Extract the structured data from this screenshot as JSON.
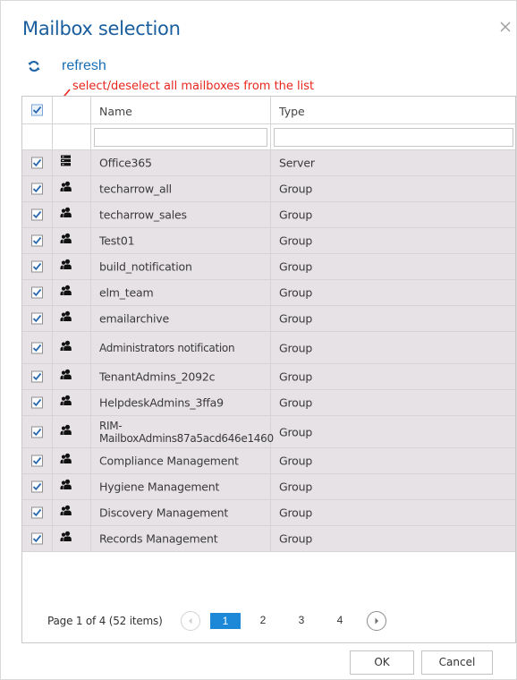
{
  "dialog": {
    "title": "Mailbox selection",
    "close_icon": "close-icon",
    "refresh_label": "refresh",
    "refresh_icon": "refresh-icon",
    "annotation": "select/deselect all mailboxes from the list"
  },
  "grid": {
    "columns": [
      "",
      "",
      "Name",
      "Type"
    ],
    "select_all_checked": true,
    "filter_name_value": "",
    "filter_type_value": "",
    "rows": [
      {
        "checked": true,
        "icon": "server-icon",
        "name": "Office365",
        "type": "Server"
      },
      {
        "checked": true,
        "icon": "group-icon",
        "name": "techarrow_all",
        "type": "Group"
      },
      {
        "checked": true,
        "icon": "group-icon",
        "name": "techarrow_sales",
        "type": "Group"
      },
      {
        "checked": true,
        "icon": "group-icon",
        "name": "Test01",
        "type": "Group"
      },
      {
        "checked": true,
        "icon": "group-icon",
        "name": "build_notification",
        "type": "Group"
      },
      {
        "checked": true,
        "icon": "group-icon",
        "name": "elm_team",
        "type": "Group"
      },
      {
        "checked": true,
        "icon": "group-icon",
        "name": "emailarchive",
        "type": "Group"
      },
      {
        "checked": true,
        "icon": "group-icon",
        "name": "Administrators notification",
        "type": "Group"
      },
      {
        "checked": true,
        "icon": "group-icon",
        "name": "TenantAdmins_2092c",
        "type": "Group"
      },
      {
        "checked": true,
        "icon": "group-icon",
        "name": "HelpdeskAdmins_3ffa9",
        "type": "Group"
      },
      {
        "checked": true,
        "icon": "group-icon",
        "name": "RIM-MailboxAdmins87a5acd646e1460",
        "type": "Group"
      },
      {
        "checked": true,
        "icon": "group-icon",
        "name": "Compliance Management",
        "type": "Group"
      },
      {
        "checked": true,
        "icon": "group-icon",
        "name": "Hygiene Management",
        "type": "Group"
      },
      {
        "checked": true,
        "icon": "group-icon",
        "name": "Discovery Management",
        "type": "Group"
      },
      {
        "checked": true,
        "icon": "group-icon",
        "name": "Records Management",
        "type": "Group"
      }
    ]
  },
  "pager": {
    "info": "Page 1 of 4 (52 items)",
    "pages": [
      "1",
      "2",
      "3",
      "4"
    ],
    "current_page": "1",
    "prev_icon": "chevron-left-icon",
    "next_icon": "chevron-right-icon"
  },
  "buttons": {
    "ok": "OK",
    "cancel": "Cancel"
  },
  "colors": {
    "title": "#1a5e9e",
    "link": "#1a6fb5",
    "annotation": "#e8261e",
    "row_bg": "#e6e2e6",
    "active_page": "#1e88d8",
    "checkbox_check": "#2a67b1"
  }
}
